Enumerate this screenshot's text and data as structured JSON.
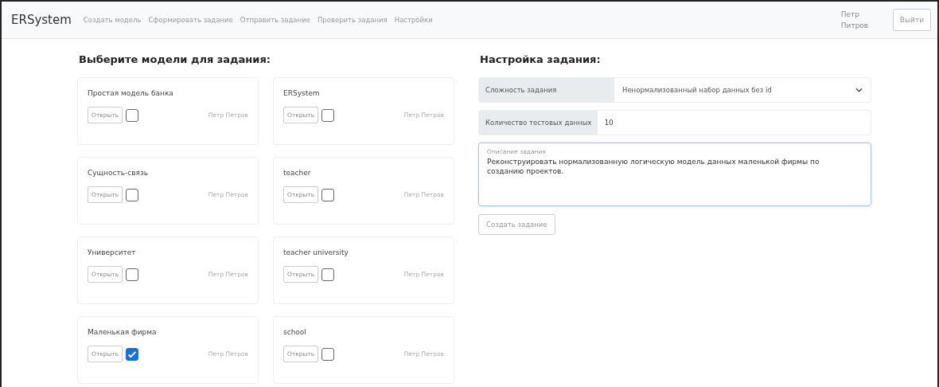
{
  "navbar": {
    "brand": "ERSystem",
    "links": [
      "Создать модель",
      "Сформировать задание",
      "Отправить задание",
      "Проверить задания",
      "Настройки"
    ],
    "user": "Петр Питров",
    "logout": "Выйти"
  },
  "models_section": {
    "title": "Выберите модели для задания:",
    "models": [
      {
        "name": "Простая модель банка",
        "open_label": "Открыть",
        "checked": false,
        "owner": "Петр Петров"
      },
      {
        "name": "ERSystem",
        "open_label": "Открыть",
        "checked": false,
        "owner": "Петр Петров"
      },
      {
        "name": "Сущность-связь",
        "open_label": "Открыть",
        "checked": false,
        "owner": "Петр Петров"
      },
      {
        "name": "teacher",
        "open_label": "Открыть",
        "checked": false,
        "owner": "Петр Петров"
      },
      {
        "name": "Университет",
        "open_label": "Открыть",
        "checked": false,
        "owner": "Петр Петров"
      },
      {
        "name": "teacher university",
        "open_label": "Открыть",
        "checked": false,
        "owner": "Петр Петров"
      },
      {
        "name": "Маленькая фирма",
        "open_label": "Открыть",
        "checked": true,
        "owner": "Петр Петров"
      },
      {
        "name": "school",
        "open_label": "Открыть",
        "checked": false,
        "owner": "Петр Петров"
      }
    ]
  },
  "settings": {
    "title": "Настройка задания:",
    "difficulty_label": "Сложность задания",
    "difficulty_value": "Ненормализованный набор данных без id",
    "count_label": "Количество тестовых данных",
    "count_value": "10",
    "description_label": "Описание задания",
    "description_value": "Реконструировать нормализованную логическую модель данных маленькой фирмы по созданию проектов.",
    "create_button": "Создать задание"
  }
}
